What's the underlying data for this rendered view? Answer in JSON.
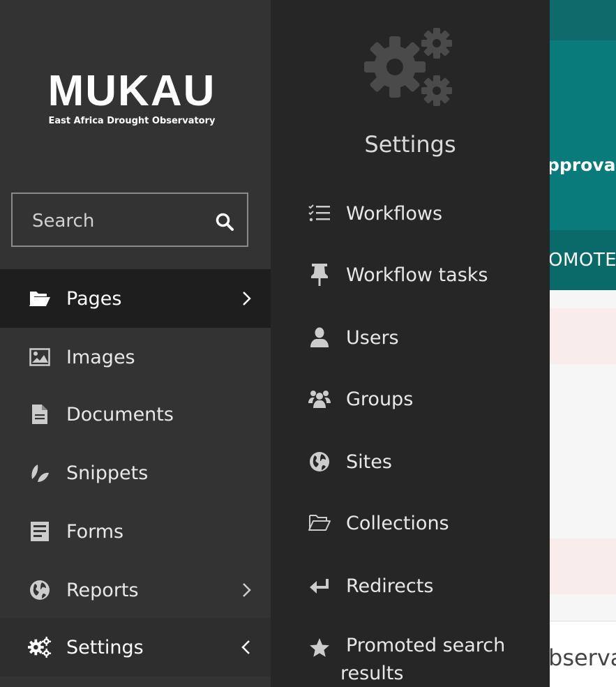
{
  "background": {
    "header_text": "pprovals",
    "tab_text": "OMOTE",
    "bottom_text": "bserva"
  },
  "sidebar": {
    "logo": {
      "title": "MUKAU",
      "subtitle": "East Africa Drought Observatory"
    },
    "search": {
      "placeholder": "Search",
      "value": ""
    },
    "items": [
      {
        "label": "Pages",
        "icon": "folder-open-icon",
        "has_submenu": true,
        "state": "active"
      },
      {
        "label": "Images",
        "icon": "image-icon",
        "has_submenu": false
      },
      {
        "label": "Documents",
        "icon": "document-icon",
        "has_submenu": false
      },
      {
        "label": "Snippets",
        "icon": "leaf-icon",
        "has_submenu": false
      },
      {
        "label": "Forms",
        "icon": "form-icon",
        "has_submenu": false
      },
      {
        "label": "Reports",
        "icon": "globe-icon",
        "has_submenu": true
      },
      {
        "label": "Settings",
        "icon": "cogs-icon",
        "has_submenu": true,
        "state": "open"
      }
    ]
  },
  "submenu": {
    "title": "Settings",
    "icon": "cogs-icon",
    "items": [
      {
        "label": "Workflows",
        "icon": "tasks-icon"
      },
      {
        "label": "Workflow tasks",
        "icon": "thumbtack-icon"
      },
      {
        "label": "Users",
        "icon": "user-icon"
      },
      {
        "label": "Groups",
        "icon": "group-icon"
      },
      {
        "label": "Sites",
        "icon": "globe-icon"
      },
      {
        "label": "Collections",
        "icon": "folder-open-icon"
      },
      {
        "label": "Redirects",
        "icon": "redirect-icon"
      },
      {
        "label": "Promoted search results",
        "icon": "star-icon"
      }
    ]
  },
  "colors": {
    "sidebar_bg": "#333333",
    "sidebar_active_bg": "#1e1e1e",
    "submenu_bg": "#262626",
    "teal": "#097b7b"
  }
}
